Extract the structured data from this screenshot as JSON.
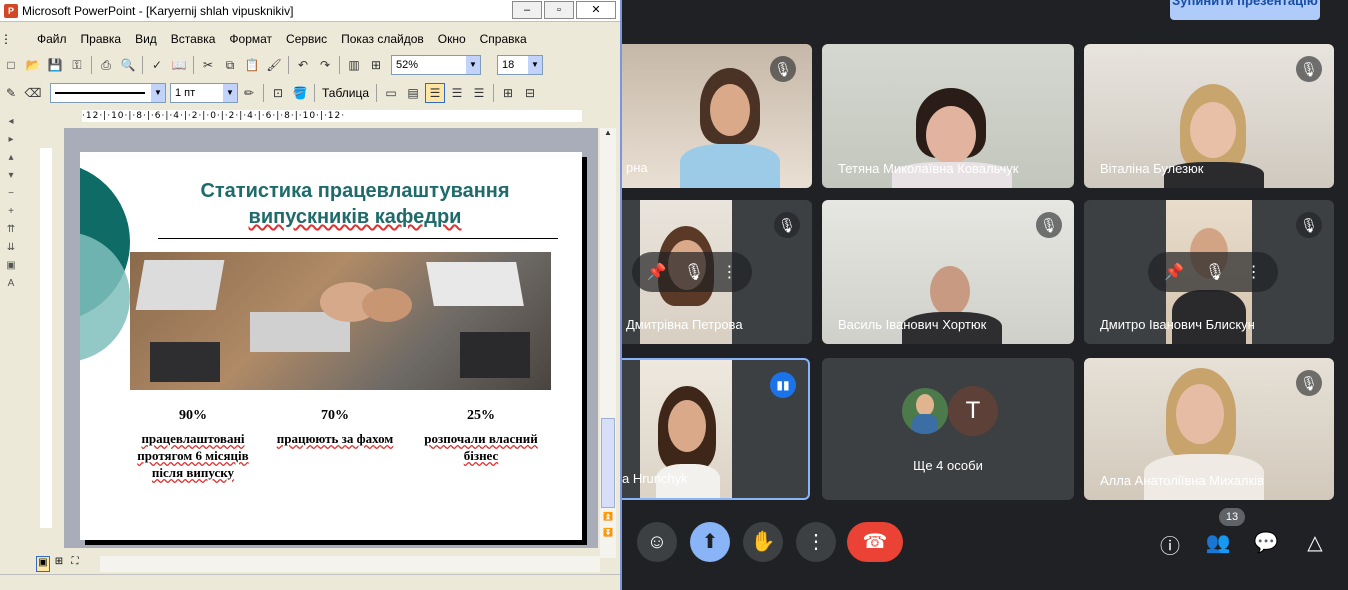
{
  "meet": {
    "stop_presenting": "Зупинити презентацію",
    "participants": [
      {
        "name": "рна",
        "muted": true
      },
      {
        "name": "Тетяна Миколаївна Ковальчук",
        "muted": false
      },
      {
        "name": "Віталіна Булезюк",
        "muted": true
      },
      {
        "name": "Дмитрівна Петрова",
        "muted": true
      },
      {
        "name": "Василь Іванович Хортюк",
        "muted": true
      },
      {
        "name": "Дмитро Іванович Блискун",
        "muted": true
      },
      {
        "name": "a Hrunchyk",
        "speaking": true
      },
      {
        "name": "Алла Анатоліївна Михалків",
        "muted": true
      }
    ],
    "others_tile": {
      "label": "Ще 4 особи",
      "avatar_letter": "T"
    },
    "participant_count": "13",
    "controls": [
      "emoji-icon",
      "present-icon",
      "raise-hand-icon",
      "more-icon",
      "end-call-icon"
    ],
    "right_controls": [
      "info-icon",
      "people-icon",
      "chat-icon",
      "activities-icon"
    ]
  },
  "ppt": {
    "window_title": "Microsoft PowerPoint - [Karyernij shlah vipusknikiv]",
    "window_buttons": {
      "minimize": "–",
      "restore": "▫",
      "close": "✕"
    },
    "menu": [
      "Файл",
      "Правка",
      "Вид",
      "Вставка",
      "Формат",
      "Сервис",
      "Показ слайдов",
      "Окно",
      "Справка"
    ],
    "zoom": "52%",
    "font_size": "18",
    "line_width": "1 пт",
    "table_label": "Таблица",
    "ruler_text": "·12·|·10·|·8·|·6·|·4·|·2·|·0·|·2·|·4·|·6·|·8·|·10·|·12·",
    "slide": {
      "title_line1": "Статистика працевлаштування",
      "title_line2": "випускників кафедри",
      "stats": [
        {
          "pct": "90%",
          "desc": "працевлаштовані протягом 6 місяців після випуску"
        },
        {
          "pct": "70%",
          "desc": "працюють за фахом"
        },
        {
          "pct": "25%",
          "desc": "розпочали власний бізнес"
        }
      ]
    }
  },
  "colors": {
    "meet_bg": "#202124",
    "tile_bg": "#3c4043",
    "accent_blue": "#8ab4f8",
    "end_red": "#ea4335",
    "slide_title": "#1f6b6b",
    "teal_shape": "#0e6b66",
    "teal_light": "#7fbfbc"
  }
}
